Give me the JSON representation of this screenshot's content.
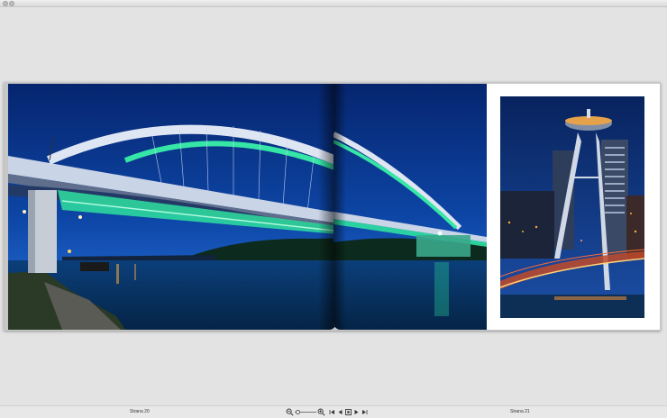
{
  "window": {
    "buttons": [
      "close",
      "minimize"
    ]
  },
  "book": {
    "left_page_label": "Strana 20",
    "right_page_label": "Strana 21",
    "left_photo": "apollo-bridge-night",
    "right_photo": "ufo-tower-bridge-night"
  },
  "toolbar": {
    "icons": [
      "zoom-out-icon",
      "zoom-in-icon",
      "first-page-icon",
      "previous-page-icon",
      "fullscreen-icon",
      "next-page-icon",
      "last-page-icon"
    ],
    "zoom_level": 0.05
  },
  "colors": {
    "background": "#e3e3e3",
    "sky": "#0d3f9c",
    "bridge_light": "#2fe0a0"
  }
}
